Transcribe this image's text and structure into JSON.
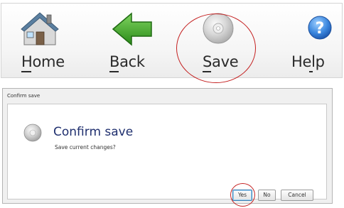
{
  "toolbar": {
    "buttons": [
      {
        "label": "Home",
        "mnemonic": "H",
        "icon": "house-icon"
      },
      {
        "label": "Back",
        "mnemonic": "B",
        "icon": "green-back-arrow-icon"
      },
      {
        "label": "Save",
        "mnemonic": "S",
        "icon": "disc-icon"
      },
      {
        "label": "Help",
        "mnemonic": "l",
        "icon": "question-mark-icon"
      }
    ]
  },
  "dialog": {
    "window_title": "Confirm save",
    "heading": "Confirm save",
    "message": "Save current changes?",
    "icon": "disc-icon",
    "buttons": {
      "yes": "Yes",
      "no": "No",
      "cancel": "Cancel"
    }
  },
  "colors": {
    "highlight_circle": "#c42020",
    "heading_text": "#1f2f6e",
    "back_arrow": "#2e9e1e",
    "help_icon": "#2a6fd0"
  }
}
